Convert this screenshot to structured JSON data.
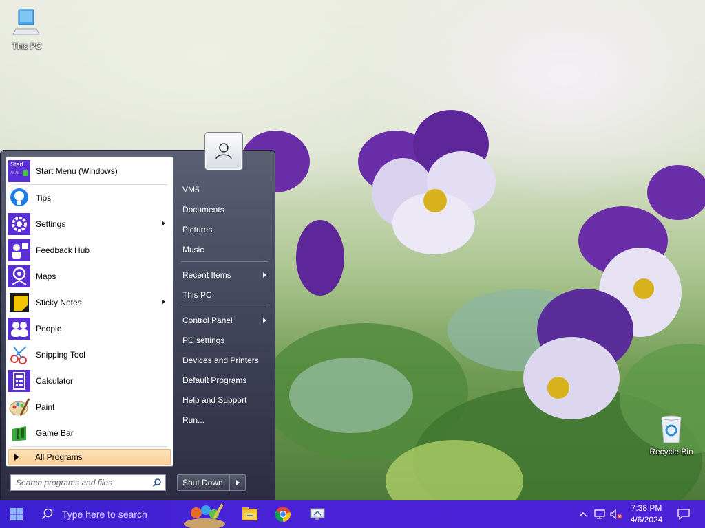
{
  "desktop": {
    "icons": [
      {
        "label": "This PC",
        "icon": "computer-icon"
      },
      {
        "label": "Recycle Bin",
        "icon": "recycle-bin-icon"
      }
    ]
  },
  "start_menu": {
    "pinned": {
      "label": "Start Menu (Windows)",
      "icon_text": "Start",
      "icon_subtext": "Alt  Alt"
    },
    "programs": [
      {
        "label": "Tips",
        "icon": "tips-icon",
        "submenu": false
      },
      {
        "label": "Settings",
        "icon": "settings-icon",
        "submenu": true
      },
      {
        "label": "Feedback Hub",
        "icon": "feedback-hub-icon",
        "submenu": false
      },
      {
        "label": "Maps",
        "icon": "maps-icon",
        "submenu": false
      },
      {
        "label": "Sticky Notes",
        "icon": "sticky-notes-icon",
        "submenu": true
      },
      {
        "label": "People",
        "icon": "people-icon",
        "submenu": false
      },
      {
        "label": "Snipping Tool",
        "icon": "snipping-tool-icon",
        "submenu": false
      },
      {
        "label": "Calculator",
        "icon": "calculator-icon",
        "submenu": false
      },
      {
        "label": "Paint",
        "icon": "paint-icon",
        "submenu": false
      },
      {
        "label": "Game Bar",
        "icon": "game-bar-icon",
        "submenu": false
      }
    ],
    "all_programs_label": "All Programs",
    "search_placeholder": "Search programs and files",
    "right_items": [
      {
        "label": "VM5",
        "submenu": false
      },
      {
        "label": "Documents",
        "submenu": false
      },
      {
        "label": "Pictures",
        "submenu": false
      },
      {
        "label": "Music",
        "submenu": false
      },
      {
        "label": "Recent Items",
        "submenu": true
      },
      {
        "label": "This PC",
        "submenu": false
      },
      {
        "label": "Control Panel",
        "submenu": true
      },
      {
        "label": "PC settings",
        "submenu": false
      },
      {
        "label": "Devices and Printers",
        "submenu": false
      },
      {
        "label": "Default Programs",
        "submenu": false
      },
      {
        "label": "Help and Support",
        "submenu": false
      },
      {
        "label": "Run...",
        "submenu": false
      }
    ],
    "shutdown_label": "Shut Down"
  },
  "taskbar": {
    "search_placeholder": "Type here to search",
    "apps": [
      "paint-3d-icon",
      "file-explorer-icon",
      "chrome-icon",
      "remote-desktop-icon"
    ],
    "time": "7:38 PM",
    "date": "4/6/2024"
  },
  "colors": {
    "taskbar": "#4522d6",
    "icon_purple": "#5b2fd6",
    "menu_dark": "#3d3f55",
    "all_programs_highlight": "#fbd9a8"
  }
}
